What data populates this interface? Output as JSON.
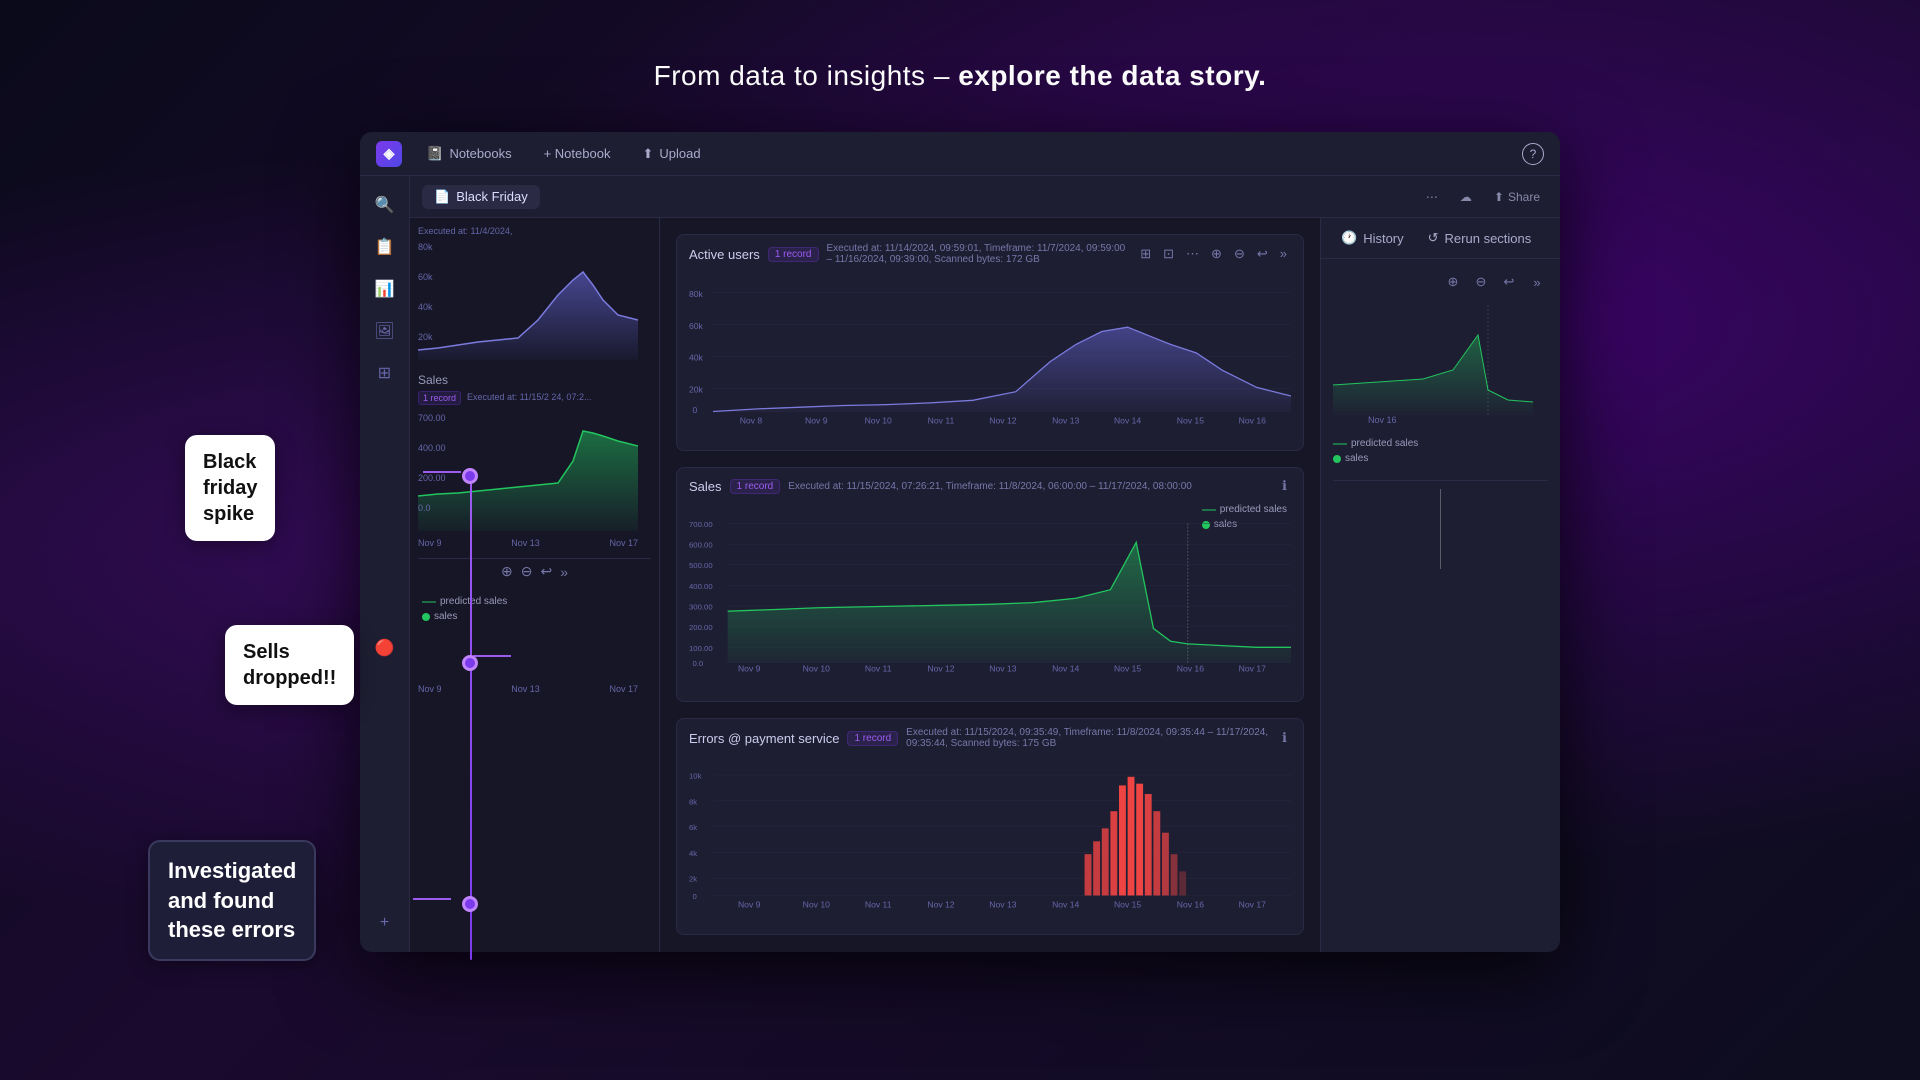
{
  "headline": {
    "prefix": "From data to insights – ",
    "bold": "explore the data story."
  },
  "topbar": {
    "notebooks_label": "Notebooks",
    "new_notebook_label": "+ Notebook",
    "upload_label": "Upload"
  },
  "tab": {
    "name": "Black Friday",
    "share_label": "Share",
    "history_label": "History",
    "rerun_label": "Rerun sections"
  },
  "charts": [
    {
      "id": "active-users",
      "title": "Active users",
      "badge": "1 record",
      "meta": "Executed at: 11/14/2024, 09:59:01, Timeframe: 11/7/2024, 09:59:00 – 11/16/2024, 09:39:00, Scanned bytes: 172 GB",
      "x_labels": [
        "Nov 8",
        "Nov 9",
        "Nov 10",
        "Nov 11",
        "Nov 12",
        "Nov 13",
        "Nov 14",
        "Nov 15",
        "Nov 16"
      ],
      "y_labels": [
        "80k",
        "60k",
        "40k",
        "20k",
        "0"
      ],
      "color": "#5b5bbf",
      "type": "area_blue"
    },
    {
      "id": "sales",
      "title": "Sales",
      "badge": "1 record",
      "meta": "Executed at: 11/15/2024, 07:26:21, Timeframe: 11/8/2024, 06:00:00 – 11/17/2024, 08:00:00",
      "x_labels": [
        "Nov 9",
        "Nov 10",
        "Nov 11",
        "Nov 12",
        "Nov 13",
        "Nov 14",
        "Nov 15",
        "Nov 16",
        "Nov 17"
      ],
      "y_labels": [
        "700.00",
        "600.00",
        "500.00",
        "400.00",
        "300.00",
        "200.00",
        "100.00",
        "0.0"
      ],
      "color": "#22c55e",
      "legend": [
        "predicted sales",
        "sales"
      ],
      "type": "area_green"
    },
    {
      "id": "errors",
      "title": "Errors @ payment service",
      "badge": "1 record",
      "meta": "Executed at: 11/15/2024, 09:35:49, Timeframe: 11/8/2024, 09:35:44 – 11/17/2024, 09:35:44, Scanned bytes: 175 GB",
      "x_labels": [
        "Nov 9",
        "Nov 10",
        "Nov 11",
        "Nov 12",
        "Nov 13",
        "Nov 14",
        "Nov 15",
        "Nov 16",
        "Nov 17"
      ],
      "y_labels": [
        "10k",
        "8k",
        "6k",
        "4k",
        "2k",
        "0"
      ],
      "color": "#ef4444",
      "type": "bar_red"
    }
  ],
  "annotations": [
    {
      "id": "black-friday-spike",
      "text": "Black friday spike",
      "style": "white"
    },
    {
      "id": "sells-dropped",
      "text": "Sells dropped!!",
      "style": "white"
    },
    {
      "id": "investigated-errors",
      "text": "Investigated and found these errors",
      "style": "dark"
    }
  ],
  "history": {
    "title": "History",
    "rerun_label": "Rerun sections",
    "legend_predicted": "predicted sales",
    "legend_sales": "sales"
  },
  "sidebar_icons": [
    "🔍",
    "📋",
    "📊",
    "📷",
    "⊞",
    "🔴"
  ]
}
